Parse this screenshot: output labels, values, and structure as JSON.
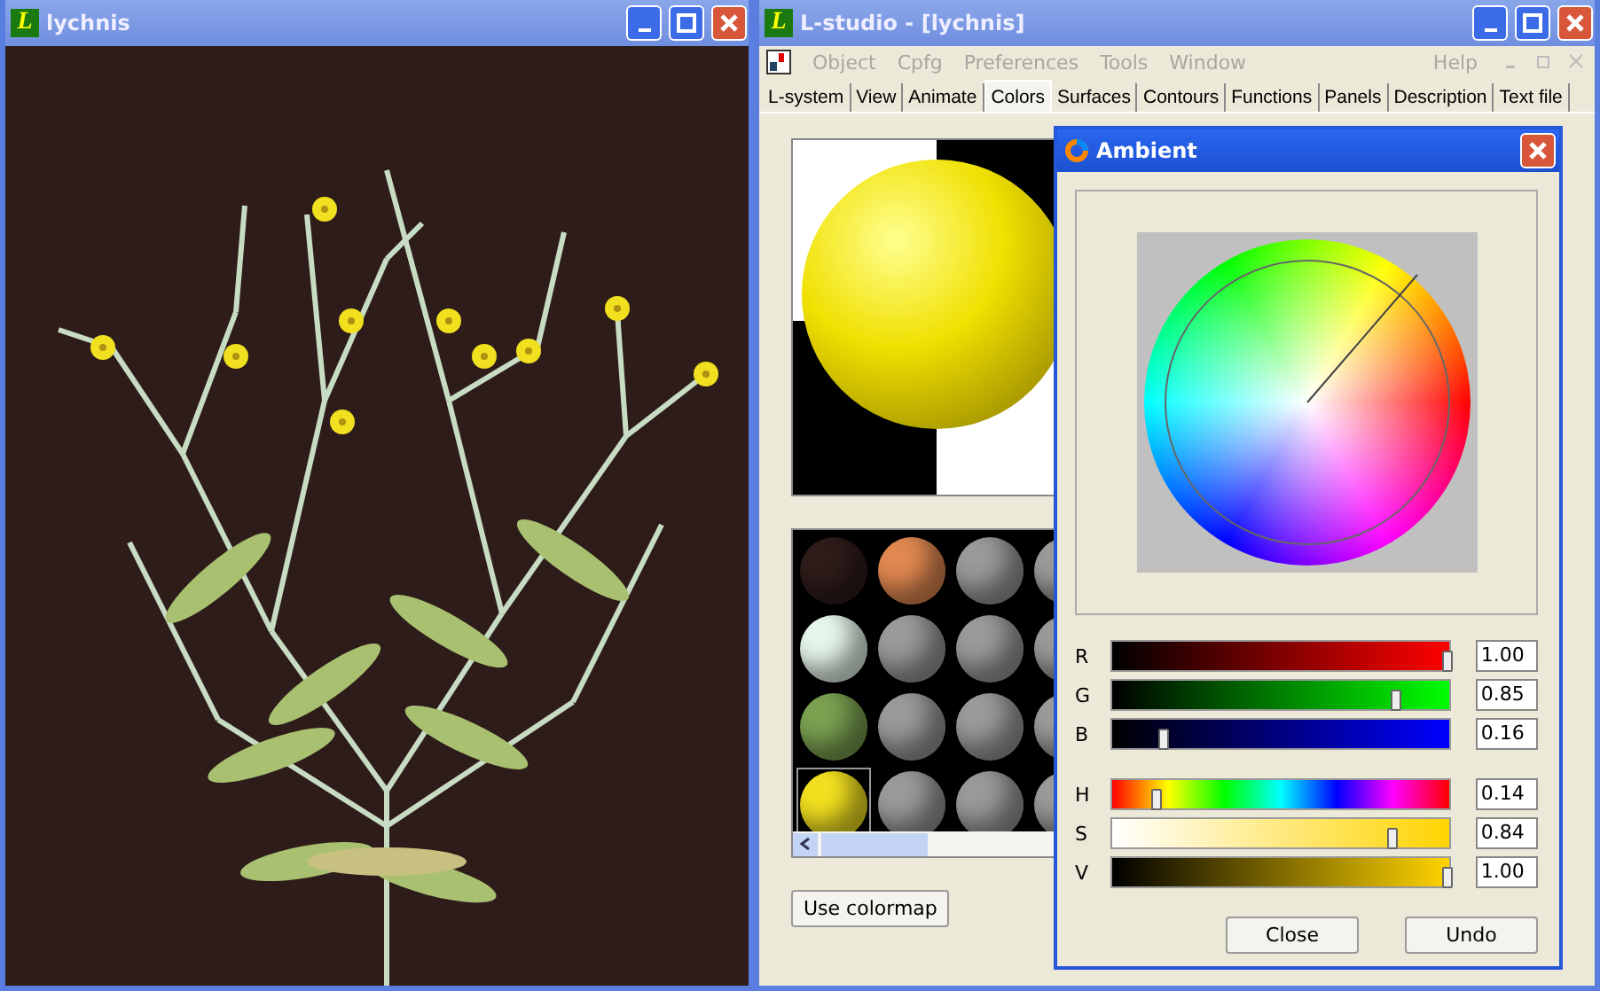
{
  "plant_window": {
    "logo": "L",
    "title": "lychnis"
  },
  "studio_window": {
    "logo": "L",
    "title": "L-studio - [lychnis]",
    "menu": [
      {
        "label": "Object",
        "disabled": true
      },
      {
        "label": "Cpfg",
        "disabled": true
      },
      {
        "label": "Preferences",
        "disabled": true
      },
      {
        "label": "Tools",
        "disabled": true
      },
      {
        "label": "Window",
        "disabled": true
      }
    ],
    "menu_right": {
      "label": "Help",
      "disabled": true
    },
    "tabs": [
      {
        "label": "L-system",
        "selected": false
      },
      {
        "label": "View",
        "selected": false
      },
      {
        "label": "Animate",
        "selected": false
      },
      {
        "label": "Colors",
        "selected": true
      },
      {
        "label": "Surfaces",
        "selected": false
      },
      {
        "label": "Contours",
        "selected": false
      },
      {
        "label": "Functions",
        "selected": false
      },
      {
        "label": "Panels",
        "selected": false
      },
      {
        "label": "Description",
        "selected": false
      },
      {
        "label": "Text file",
        "selected": false
      }
    ],
    "swatches": [
      {
        "color": "#2e1c1a",
        "selected": false
      },
      {
        "color": "#e08850",
        "selected": false
      },
      {
        "color": "#9a9a9a",
        "selected": false
      },
      {
        "color": "#9a9a9a",
        "selected": false
      },
      {
        "color": "#e6f6ea",
        "selected": false
      },
      {
        "color": "#9a9a9a",
        "selected": false
      },
      {
        "color": "#9a9a9a",
        "selected": false
      },
      {
        "color": "#9a9a9a",
        "selected": false
      },
      {
        "color": "#7aa050",
        "selected": false
      },
      {
        "color": "#9a9a9a",
        "selected": false
      },
      {
        "color": "#9a9a9a",
        "selected": false
      },
      {
        "color": "#9a9a9a",
        "selected": false
      },
      {
        "color": "#f2e020",
        "selected": true
      },
      {
        "color": "#9a9a9a",
        "selected": false
      },
      {
        "color": "#9a9a9a",
        "selected": false
      },
      {
        "color": "#9a9a9a",
        "selected": false
      }
    ],
    "use_colormap_button": "Use colormap"
  },
  "dialog": {
    "title": "Ambient",
    "sliders": [
      {
        "label": "R",
        "kind": "red",
        "level": 1.0,
        "reading": "1.00"
      },
      {
        "label": "G",
        "kind": "green",
        "level": 0.85,
        "reading": "0.85"
      },
      {
        "label": "B",
        "kind": "blue",
        "level": 0.16,
        "reading": "0.16"
      },
      {
        "label": "H",
        "kind": "hue",
        "level": 0.14,
        "reading": "0.14"
      },
      {
        "label": "S",
        "kind": "saturation",
        "level": 0.84,
        "reading": "0.84"
      },
      {
        "label": "V",
        "kind": "value",
        "level": 1.0,
        "reading": "1.00"
      }
    ],
    "buttons": [
      "Close",
      "Undo"
    ]
  }
}
